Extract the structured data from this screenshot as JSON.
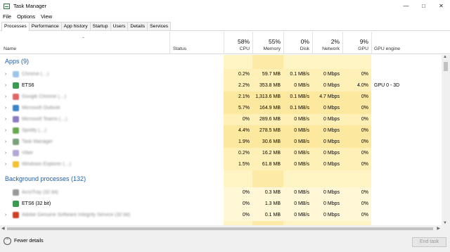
{
  "window": {
    "title": "Task Manager"
  },
  "menu": [
    "File",
    "Options",
    "View"
  ],
  "tabs": [
    "Processes",
    "Performance",
    "App history",
    "Startup",
    "Users",
    "Details",
    "Services"
  ],
  "header": {
    "name": "Name",
    "status": "Status",
    "cpu_pct": "58%",
    "cpu": "CPU",
    "memory_pct": "55%",
    "memory": "Memory",
    "disk_pct": "0%",
    "disk": "Disk",
    "network_pct": "2%",
    "network": "Network",
    "gpu_pct": "9%",
    "gpu": "GPU",
    "gpu_engine": "GPU engine"
  },
  "groups": {
    "apps": "Apps (9)",
    "background": "Background processes (132)"
  },
  "apps": [
    {
      "name": "Chrome (…)",
      "blurred": true,
      "cpu": "0.2%",
      "memory": "59.7 MB",
      "disk": "0.1 MB/s",
      "network": "0 Mbps",
      "gpu": "0%",
      "gpu_engine": "",
      "icon_color": "#9fc5e8",
      "level": 2
    },
    {
      "name": "ETS6",
      "blurred": false,
      "cpu": "2.2%",
      "memory": "353.8 MB",
      "disk": "0 MB/s",
      "network": "0 Mbps",
      "gpu": "4.0%",
      "gpu_engine": "GPU 0 - 3D",
      "icon_color": "#3c9a52",
      "level": 2
    },
    {
      "name": "Google Chrome (…)",
      "blurred": true,
      "cpu": "2.1%",
      "memory": "1,313.6 MB",
      "disk": "0.1 MB/s",
      "network": "4.7 Mbps",
      "gpu": "0%",
      "gpu_engine": "",
      "icon_color": "#e06666",
      "level": 3
    },
    {
      "name": "Microsoft Outlook",
      "blurred": true,
      "cpu": "5.7%",
      "memory": "164.9 MB",
      "disk": "0.1 MB/s",
      "network": "0 Mbps",
      "gpu": "0%",
      "gpu_engine": "",
      "icon_color": "#3d85c6",
      "level": 3
    },
    {
      "name": "Microsoft Teams (…)",
      "blurred": true,
      "cpu": "0%",
      "memory": "289.6 MB",
      "disk": "0 MB/s",
      "network": "0 Mbps",
      "gpu": "0%",
      "gpu_engine": "",
      "icon_color": "#8e7cc3",
      "level": 2
    },
    {
      "name": "Spotify (…)",
      "blurred": true,
      "cpu": "4.4%",
      "memory": "278.5 MB",
      "disk": "0 MB/s",
      "network": "0 Mbps",
      "gpu": "0%",
      "gpu_engine": "",
      "icon_color": "#6aa84f",
      "level": 3
    },
    {
      "name": "Task Manager",
      "blurred": true,
      "cpu": "1.9%",
      "memory": "30.6 MB",
      "disk": "0 MB/s",
      "network": "0 Mbps",
      "gpu": "0%",
      "gpu_engine": "",
      "icon_color": "#7aa07a",
      "level": 3
    },
    {
      "name": "Viber",
      "blurred": true,
      "cpu": "0.2%",
      "memory": "16.2 MB",
      "disk": "0 MB/s",
      "network": "0 Mbps",
      "gpu": "0%",
      "gpu_engine": "",
      "icon_color": "#b4a7d6",
      "level": 2
    },
    {
      "name": "Windows Explorer (…)",
      "blurred": true,
      "cpu": "1.5%",
      "memory": "61.8 MB",
      "disk": "0 MB/s",
      "network": "0 Mbps",
      "gpu": "0%",
      "gpu_engine": "",
      "icon_color": "#f1c232",
      "level": 2
    }
  ],
  "background": [
    {
      "name": "AcroTray (32 bit)",
      "blurred": true,
      "cpu": "0%",
      "memory": "0.3 MB",
      "disk": "0 MB/s",
      "network": "0 Mbps",
      "gpu": "0%",
      "gpu_engine": "",
      "icon_color": "#999999",
      "level": 1,
      "expander": false
    },
    {
      "name": "ETS6 (32 bit)",
      "blurred": false,
      "cpu": "0%",
      "memory": "1.3 MB",
      "disk": "0 MB/s",
      "network": "0 Mbps",
      "gpu": "0%",
      "gpu_engine": "",
      "icon_color": "#3c9a52",
      "level": 1,
      "expander": false
    },
    {
      "name": "Adobe Genuine Software Integrity Service (32 bit)",
      "blurred": true,
      "cpu": "0%",
      "memory": "0.1 MB",
      "disk": "0 MB/s",
      "network": "0 Mbps",
      "gpu": "0%",
      "gpu_engine": "",
      "icon_color": "#cc4125",
      "level": 1,
      "expander": true
    }
  ],
  "footer": {
    "fewer_details": "Fewer details",
    "end_task": "End task"
  },
  "colors": {
    "heat1": "#fff7d6",
    "heat2": "#fff0b8",
    "heat3": "#fde8a0",
    "group_title": "#1f5fa8"
  }
}
